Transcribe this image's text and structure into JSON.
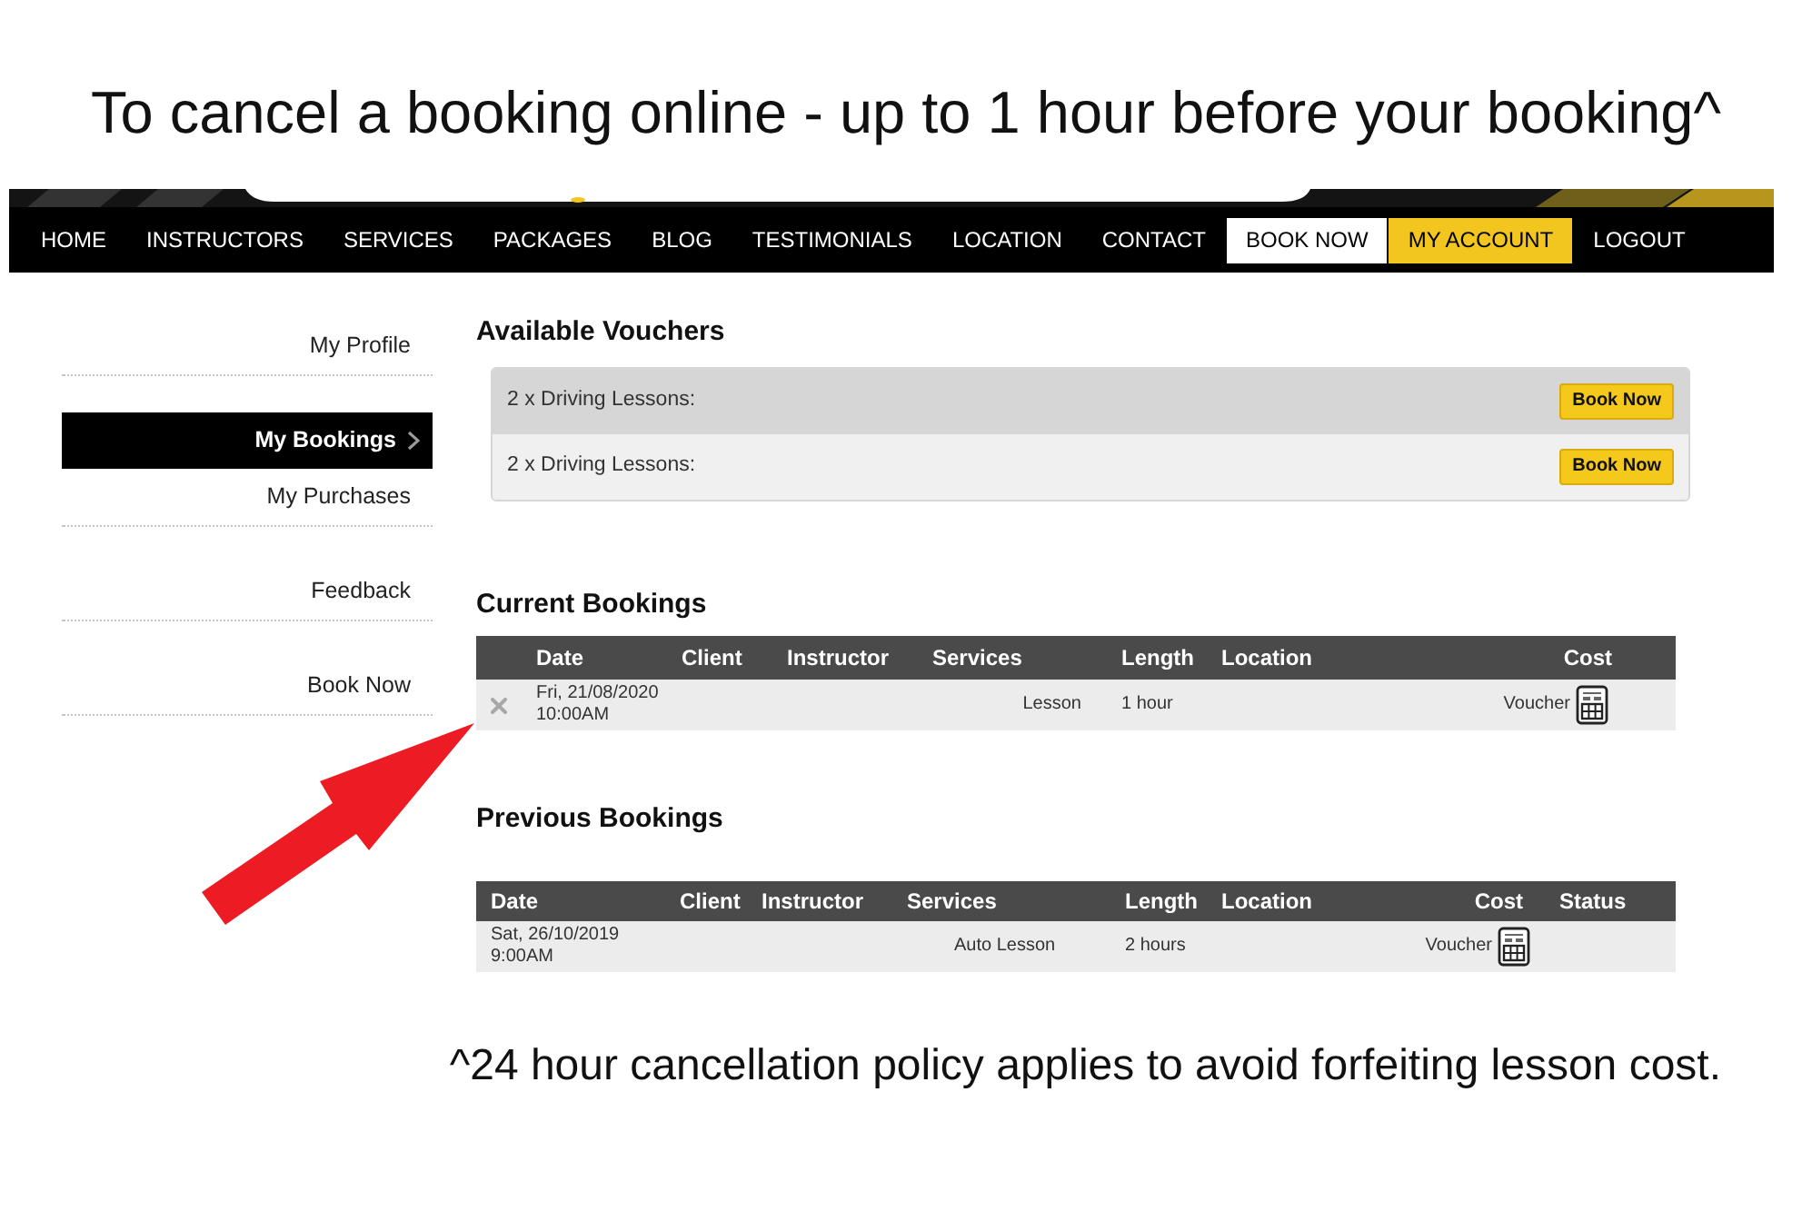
{
  "caption": "To cancel a booking online - up to 1 hour before your booking^",
  "nav": [
    {
      "label": "HOME",
      "kind": "link",
      "selected": false
    },
    {
      "label": "INSTRUCTORS",
      "kind": "link",
      "selected": false
    },
    {
      "label": "SERVICES",
      "kind": "link",
      "selected": false
    },
    {
      "label": "PACKAGES",
      "kind": "link",
      "selected": false
    },
    {
      "label": "BLOG",
      "kind": "link",
      "selected": false
    },
    {
      "label": "TESTIMONIALS",
      "kind": "link",
      "selected": false
    },
    {
      "label": "LOCATION",
      "kind": "link",
      "selected": false
    },
    {
      "label": "CONTACT",
      "kind": "link",
      "selected": false
    },
    {
      "label": "BOOK NOW",
      "kind": "cta",
      "selected": false
    },
    {
      "label": "MY ACCOUNT",
      "kind": "link",
      "selected": true
    },
    {
      "label": "LOGOUT",
      "kind": "link",
      "selected": false
    }
  ],
  "sidebar": {
    "items": [
      {
        "label": "My Profile",
        "selected": false
      },
      {
        "label": "My Bookings",
        "selected": true
      },
      {
        "label": "My Purchases",
        "selected": false
      },
      {
        "label": "Feedback",
        "selected": false
      },
      {
        "label": "Book Now",
        "selected": false
      }
    ]
  },
  "vouchers": {
    "title": "Available Vouchers",
    "items": [
      {
        "label": "2 x Driving Lessons:",
        "button": "Book Now",
        "highlighted": true
      },
      {
        "label": "2 x Driving Lessons:",
        "button": "Book Now",
        "highlighted": false
      }
    ]
  },
  "current_bookings": {
    "title": "Current Bookings",
    "columns": [
      "Date",
      "Client",
      "Instructor",
      "Services",
      "Length",
      "Location",
      "Cost"
    ],
    "rows": [
      {
        "cancellable": true,
        "date": "Fri, 21/08/2020",
        "time": "10:00AM",
        "services": "Lesson",
        "length": "1 hour",
        "cost": "Voucher"
      }
    ]
  },
  "previous_bookings": {
    "title": "Previous Bookings",
    "columns": [
      "Date",
      "Client",
      "Instructor",
      "Services",
      "Length",
      "Location",
      "Cost",
      "Status"
    ],
    "rows": [
      {
        "date": "Sat, 26/10/2019",
        "time": "9:00AM",
        "services": "Auto Lesson",
        "length": "2 hours",
        "cost": "Voucher"
      }
    ]
  },
  "footnote": "^24 hour cancellation policy applies to avoid forfeiting lesson cost."
}
